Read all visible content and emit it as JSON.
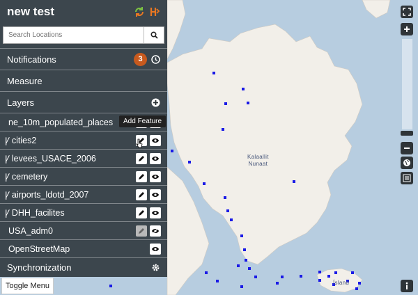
{
  "panel": {
    "title": "new test",
    "search_placeholder": "Search Locations",
    "notifications_label": "Notifications",
    "notifications_count": "3",
    "measure_label": "Measure",
    "layers_label": "Layers",
    "synchronization_label": "Synchronization"
  },
  "layers": [
    {
      "label": "ne_10m_populated_places"
    },
    {
      "label": "cities2"
    },
    {
      "label": "levees_USACE_2006"
    },
    {
      "label": "cemetery"
    },
    {
      "label": "airports_ldotd_2007"
    },
    {
      "label": "DHH_facilites"
    },
    {
      "label": "USA_adm0"
    },
    {
      "label": "OpenStreetMap"
    }
  ],
  "tooltip": "Add Feature",
  "toggle_menu": "Toggle Menu",
  "map": {
    "greenland_label_line1": "Kalaallit",
    "greenland_label_line2": "Nunaat",
    "iceland_label": "Ísland"
  },
  "colors": {
    "panel_bg": "#283034",
    "badge": "#c85a1e",
    "sync_green": "#7cc242",
    "sync_orange": "#e87722",
    "feature_point": "#1a1ae6",
    "land": "#f2efe9",
    "water": "#b7cde0"
  },
  "icons": {
    "sync_icon": "refresh-arrows",
    "hazard_icon": "orange-h",
    "search_icon": "magnifier",
    "clock_icon": "clock",
    "plus_icon": "plus-circle",
    "gear_icon": "gear",
    "pencil_icon": "pencil",
    "eye_icon": "eye"
  }
}
